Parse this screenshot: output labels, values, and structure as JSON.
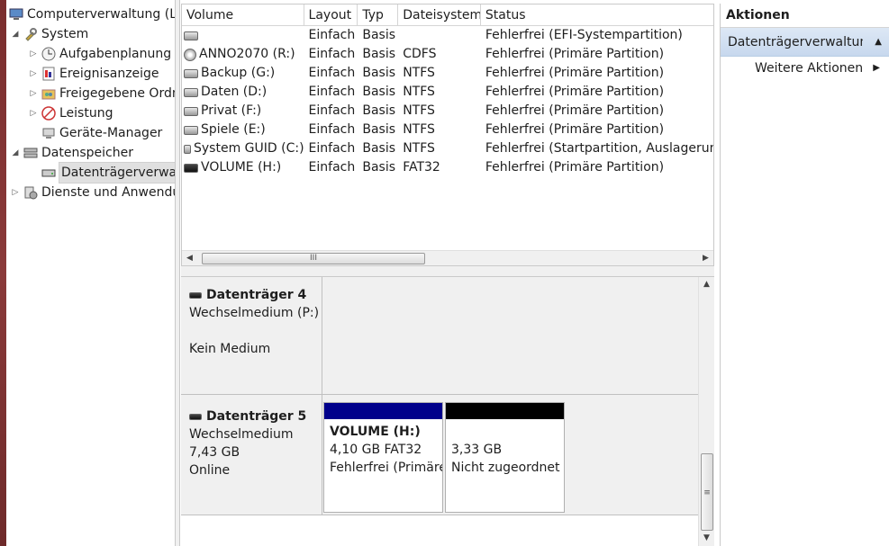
{
  "tree": {
    "root": "Computerverwaltung (Lokal)",
    "system": "System",
    "aufgaben": "Aufgabenplanung",
    "ereignis": "Ereignisanzeige",
    "freigaben": "Freigegebene Ordner",
    "leistung": "Leistung",
    "geraete": "Geräte-Manager",
    "datenspeicher": "Datenspeicher",
    "datentraeger": "Datenträgerverwaltung",
    "dienste": "Dienste und Anwendungen"
  },
  "list": {
    "headers": {
      "volume": "Volume",
      "layout": "Layout",
      "typ": "Typ",
      "fs": "Dateisystem",
      "status": "Status"
    },
    "rows": [
      {
        "volume": "",
        "layout": "Einfach",
        "typ": "Basis",
        "fs": "",
        "status": "Fehlerfrei (EFI-Systempartition)",
        "icon": "drive-icon"
      },
      {
        "volume": "ANNO2070 (R:)",
        "layout": "Einfach",
        "typ": "Basis",
        "fs": "CDFS",
        "status": "Fehlerfrei (Primäre Partition)",
        "icon": "cd-drive-icon"
      },
      {
        "volume": "Backup (G:)",
        "layout": "Einfach",
        "typ": "Basis",
        "fs": "NTFS",
        "status": "Fehlerfrei (Primäre Partition)",
        "icon": "drive-icon"
      },
      {
        "volume": "Daten (D:)",
        "layout": "Einfach",
        "typ": "Basis",
        "fs": "NTFS",
        "status": "Fehlerfrei (Primäre Partition)",
        "icon": "drive-icon"
      },
      {
        "volume": "Privat (F:)",
        "layout": "Einfach",
        "typ": "Basis",
        "fs": "NTFS",
        "status": "Fehlerfrei (Primäre Partition)",
        "icon": "drive-icon"
      },
      {
        "volume": "Spiele (E:)",
        "layout": "Einfach",
        "typ": "Basis",
        "fs": "NTFS",
        "status": "Fehlerfrei (Primäre Partition)",
        "icon": "drive-icon"
      },
      {
        "volume": "System GUID (C:)",
        "layout": "Einfach",
        "typ": "Basis",
        "fs": "NTFS",
        "status": "Fehlerfrei (Startpartition, Auslagerungsdatei",
        "icon": "drive-icon"
      },
      {
        "volume": "VOLUME (H:)",
        "layout": "Einfach",
        "typ": "Basis",
        "fs": "FAT32",
        "status": "Fehlerfrei (Primäre Partition)",
        "icon": "usb-drive-icon"
      }
    ],
    "hscroll_thumb": "III"
  },
  "disk4": {
    "name": "Datenträger 4",
    "type": "Wechselmedium (P:)",
    "state": "Kein Medium"
  },
  "disk5": {
    "name": "Datenträger 5",
    "type": "Wechselmedium",
    "size": "7,43 GB",
    "state": "Online",
    "partitions": [
      {
        "title": "VOLUME  (H:)",
        "line1": "4,10 GB FAT32",
        "line2": "Fehlerfrei (Primäre Partition)",
        "color": "#00008b"
      },
      {
        "title": "",
        "line1": "3,33 GB",
        "line2": "Nicht zugeordnet",
        "color": "#000000"
      }
    ]
  },
  "actions": {
    "title": "Aktionen",
    "section": "Datenträgerverwaltung",
    "more": "Weitere Aktionen"
  }
}
